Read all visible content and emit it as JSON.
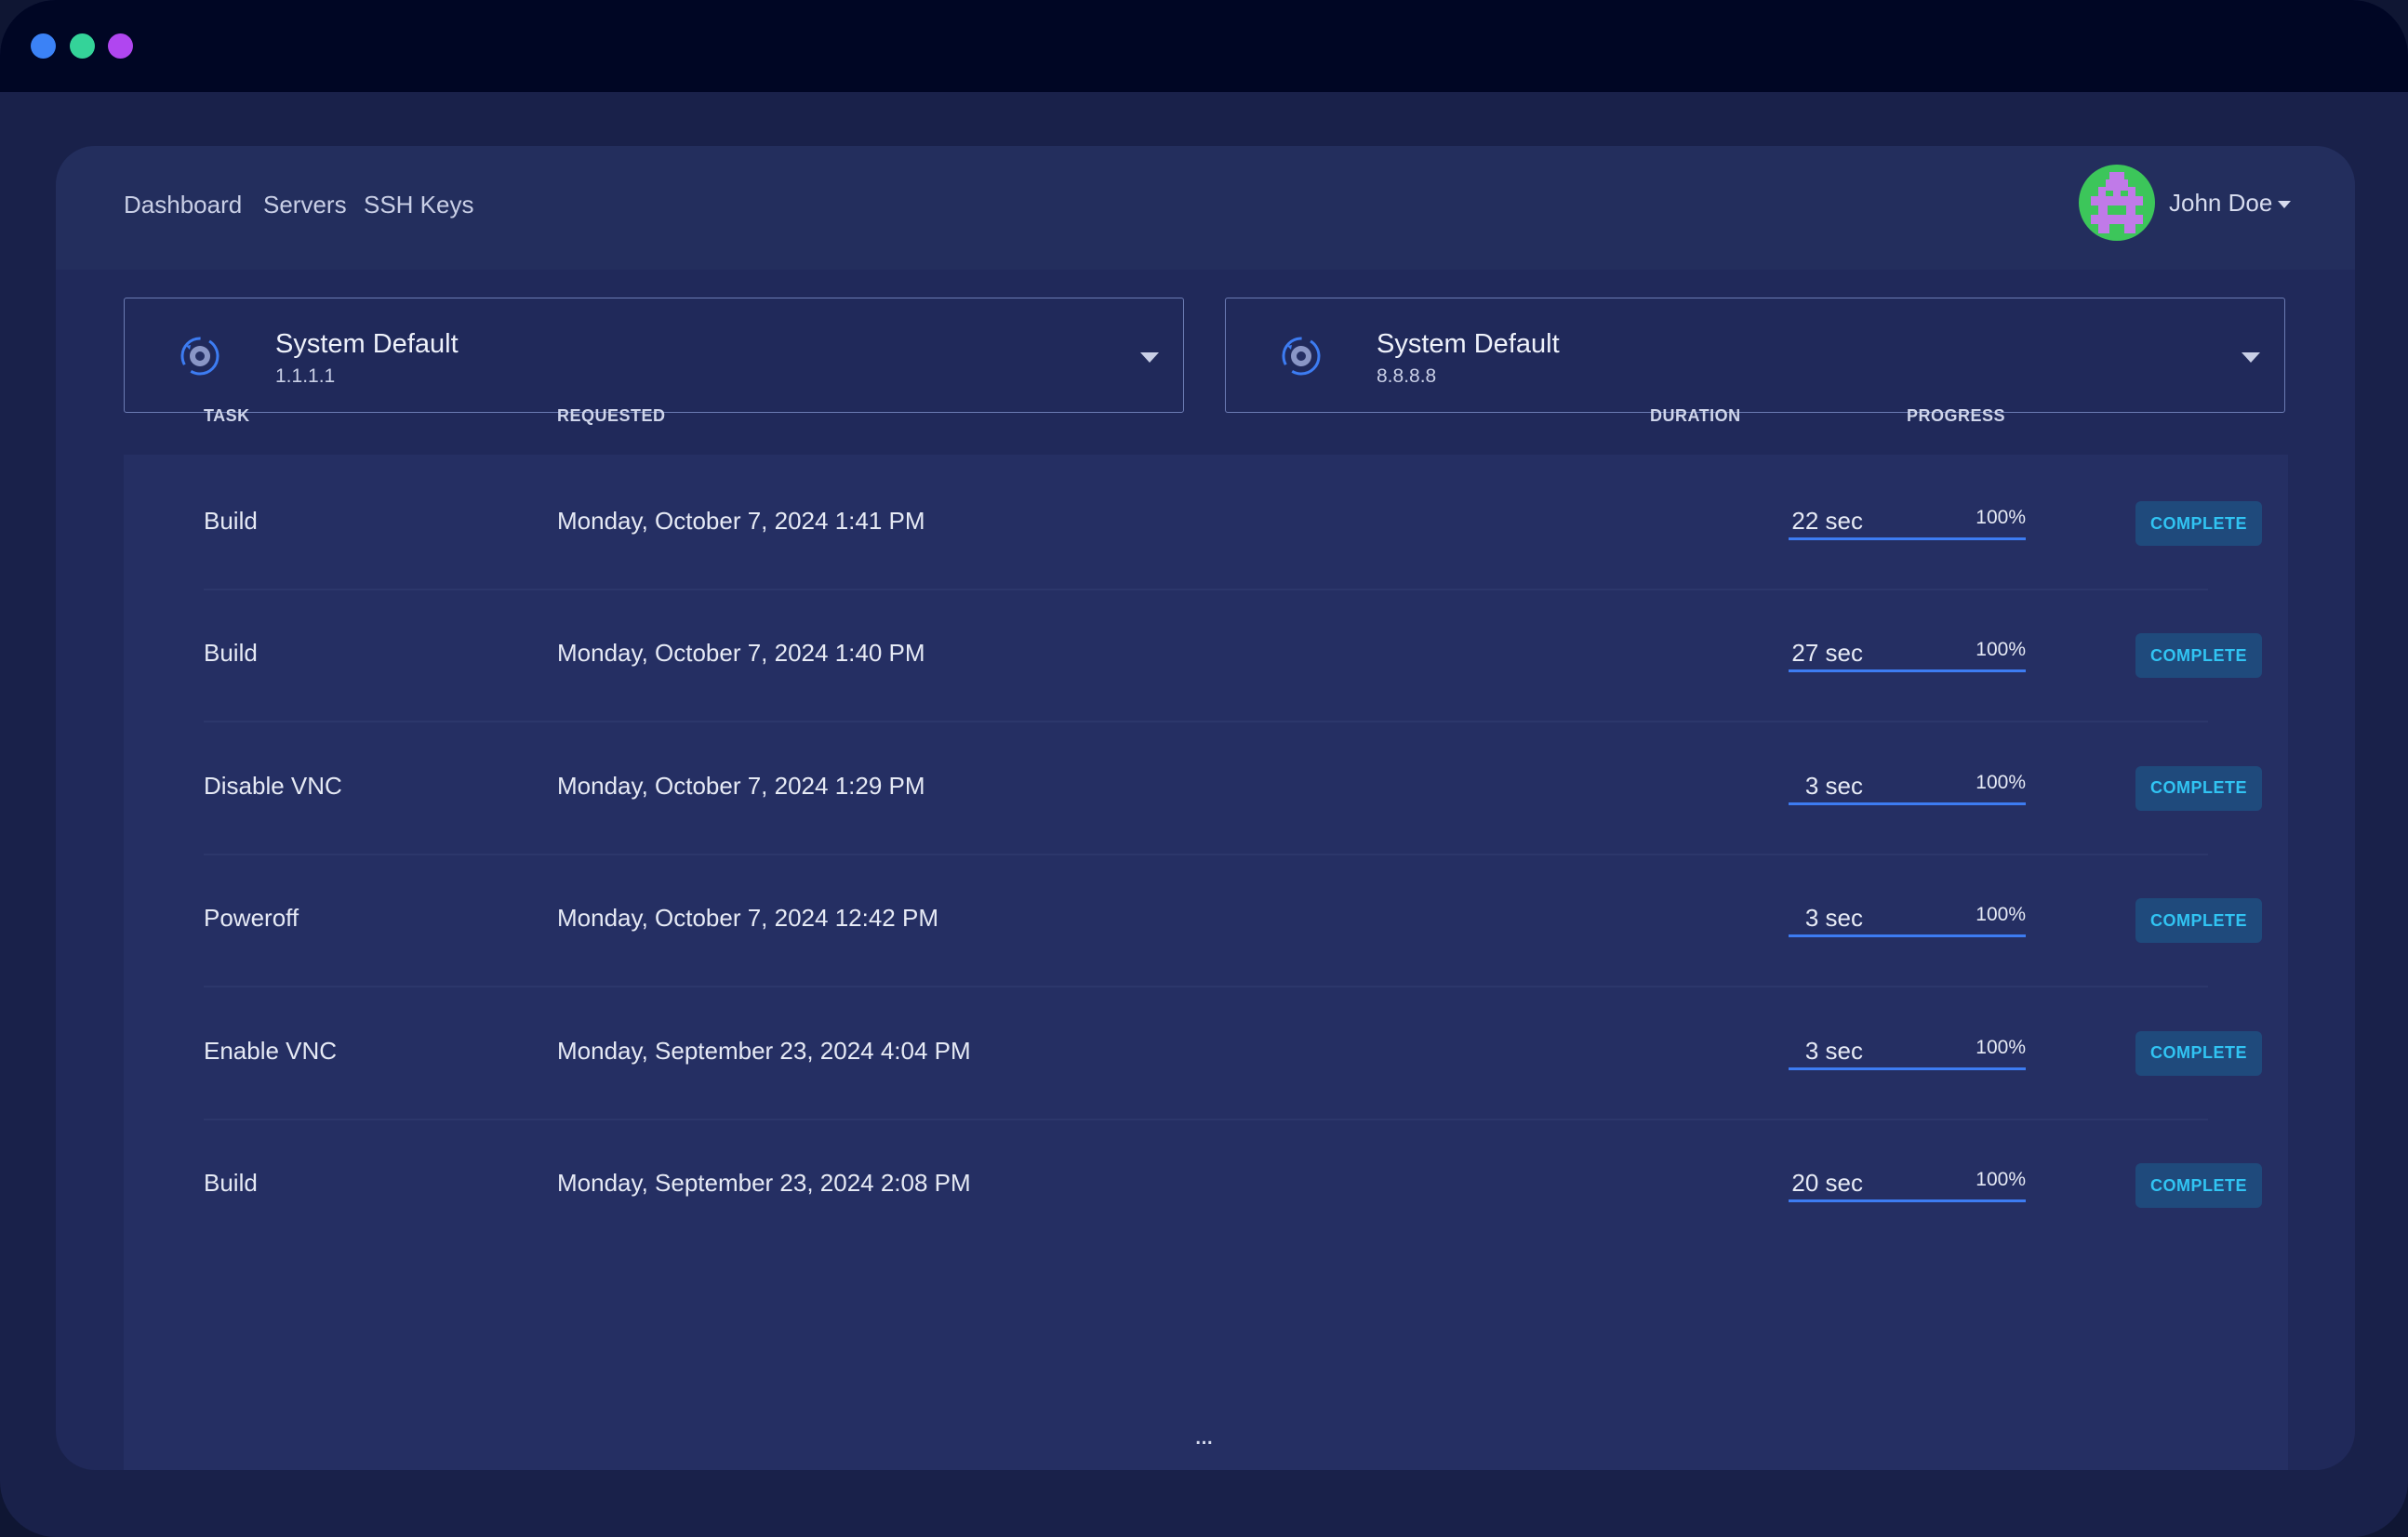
{
  "colors": {
    "titlebar": "#000624",
    "window_bg": "#19214a",
    "panel_bg": "#20295a",
    "navbar_bg": "#232e5d",
    "progress_fill": "#3d7cf2",
    "badge_bg": "#1f4a7c",
    "badge_text": "#31c4f3",
    "traffic_blue": "#3b82f6",
    "traffic_green": "#34d399",
    "traffic_purple": "#b046f0",
    "avatar_bg": "#3cc65a",
    "avatar_fg": "#c07ae8"
  },
  "nav": {
    "links": [
      {
        "label": "Dashboard"
      },
      {
        "label": "Servers"
      },
      {
        "label": "SSH Keys"
      }
    ],
    "user": {
      "name": "John Doe",
      "avatar_icon": "pixel-robot-avatar-icon"
    }
  },
  "dns": [
    {
      "name": "System Default",
      "ip": "1.1.1.1",
      "icon": "gear-cycle-icon"
    },
    {
      "name": "System Default",
      "ip": "8.8.8.8",
      "icon": "gear-cycle-icon"
    }
  ],
  "table": {
    "headers": {
      "task": "TASK",
      "requested": "REQUESTED",
      "duration": "DURATION",
      "progress": "PROGRESS"
    },
    "rows": [
      {
        "task": "Build",
        "requested": "Monday, October 7, 2024 1:41 PM",
        "duration": "22 sec",
        "progress": 100,
        "progress_label": "100%",
        "status": "COMPLETE"
      },
      {
        "task": "Build",
        "requested": "Monday, October 7, 2024 1:40 PM",
        "duration": "27 sec",
        "progress": 100,
        "progress_label": "100%",
        "status": "COMPLETE"
      },
      {
        "task": "Disable VNC",
        "requested": "Monday, October 7, 2024 1:29 PM",
        "duration": "3 sec",
        "progress": 100,
        "progress_label": "100%",
        "status": "COMPLETE"
      },
      {
        "task": "Poweroff",
        "requested": "Monday, October 7, 2024 12:42 PM",
        "duration": "3 sec",
        "progress": 100,
        "progress_label": "100%",
        "status": "COMPLETE"
      },
      {
        "task": "Enable VNC",
        "requested": "Monday, September 23, 2024 4:04 PM",
        "duration": "3 sec",
        "progress": 100,
        "progress_label": "100%",
        "status": "COMPLETE"
      },
      {
        "task": "Build",
        "requested": "Monday, September 23, 2024 2:08 PM",
        "duration": "20 sec",
        "progress": 100,
        "progress_label": "100%",
        "status": "COMPLETE"
      }
    ],
    "more": "..."
  }
}
